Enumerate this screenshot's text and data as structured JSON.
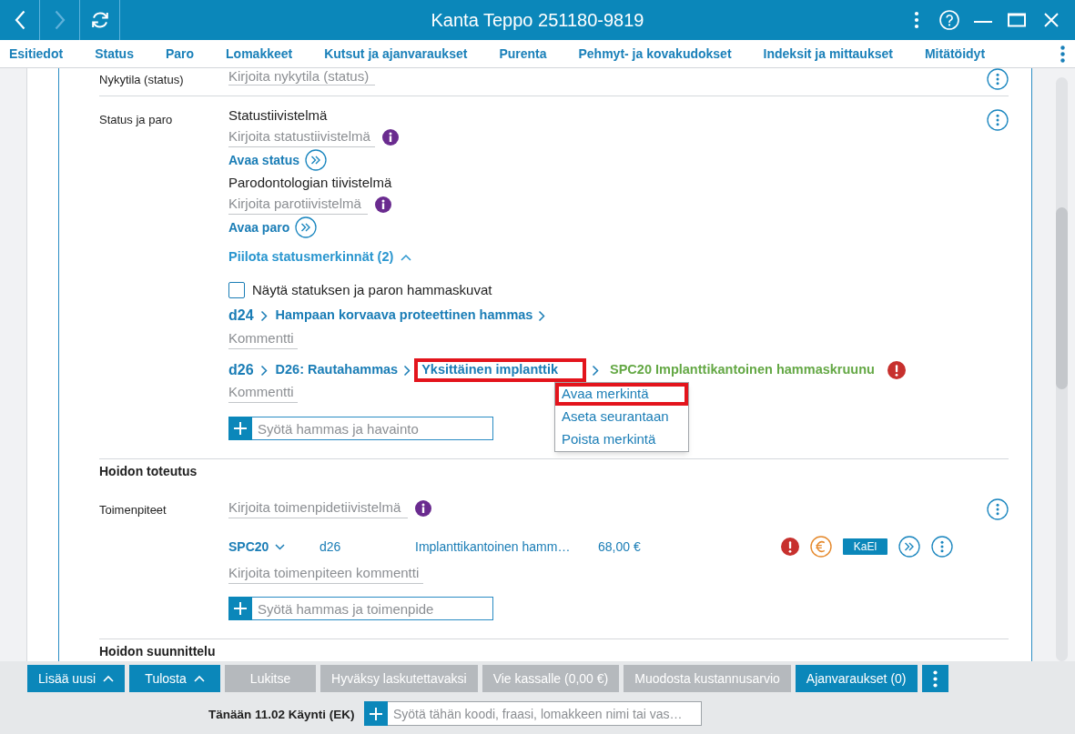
{
  "window": {
    "title": "Kanta Teppo 251180-9819"
  },
  "nav_buttons": [
    {
      "kind": "back",
      "disabled": false
    },
    {
      "kind": "forward",
      "disabled": true
    },
    {
      "kind": "refresh",
      "disabled": false
    }
  ],
  "tabs": [
    {
      "label": "Esitiedot",
      "selected": false
    },
    {
      "label": "Status",
      "selected": false
    },
    {
      "label": "Paro",
      "selected": false
    },
    {
      "label": "Lomakkeet",
      "selected": false
    },
    {
      "label": "Kutsut ja ajanvaraukset",
      "selected": false
    },
    {
      "label": "Purenta",
      "selected": false
    },
    {
      "label": "Pehmyt- ja kovakudokset",
      "selected": false
    },
    {
      "label": "Indeksit ja mittaukset",
      "selected": false
    },
    {
      "label": "Mitätöidyt",
      "selected": false
    }
  ],
  "current_state": {
    "label": "Nykytila (status)",
    "placeholder": "Kirjoita nykytila (status)"
  },
  "status_and_paro": {
    "label": "Status ja paro",
    "summaries": [
      {
        "heading": "Statustiivistelmä",
        "placeholder": "Kirjoita statustiivistelmä",
        "link": "Avaa status"
      },
      {
        "heading": "Parodontologian tiivistelmä",
        "placeholder": "Kirjoita parotiivistelmä",
        "link": "Avaa paro"
      }
    ],
    "toggle": {
      "label": "Piilota statusmerkinnät (2)",
      "expanded": true
    },
    "show_images": {
      "label": "Näytä statuksen ja paron hammaskuvat",
      "checked": false
    },
    "findings": [
      {
        "tooth": "d24",
        "path": [
          {
            "kind": "link",
            "text": "Hampaan korvaava proteettinen hammas",
            "highlighted": false
          }
        ],
        "comment_placeholder": "Kommentti",
        "warning": false
      },
      {
        "tooth": "d26",
        "path": [
          {
            "kind": "link",
            "text": "D26: Rautahammas",
            "highlighted": false
          },
          {
            "kind": "link",
            "text": "Yksittäinen implanttik",
            "highlighted": true
          },
          {
            "kind": "procedure",
            "text": "SPC20 Implanttikantoinen hammaskruunu",
            "highlighted": false
          }
        ],
        "comment_placeholder": "Kommentti",
        "warning": true,
        "menu": [
          {
            "label": "Avaa merkintä",
            "highlighted": true
          },
          {
            "label": "Aseta seurantaan",
            "highlighted": false
          },
          {
            "label": "Poista merkintä",
            "highlighted": false
          }
        ]
      }
    ],
    "add_field": {
      "placeholder": "Syötä hammas ja havainto"
    }
  },
  "treatment": {
    "heading": "Hoidon toteutus",
    "label": "Toimenpiteet",
    "placeholder": "Kirjoita toimenpidetiivistelmä",
    "procedures": [
      {
        "code": "SPC20",
        "tooth": "d26",
        "description": "Implanttikantoinen hamm…",
        "price": "68,00 €",
        "warning": true,
        "billable": true,
        "tag": "KaEl",
        "comment_placeholder": "Kirjoita toimenpiteen kommentti"
      }
    ],
    "add_field": {
      "placeholder": "Syötä hammas ja toimenpide"
    }
  },
  "planning": {
    "heading": "Hoidon suunnittelu"
  },
  "toolbar": [
    {
      "kind": "dropdown",
      "label": "Lisää uusi",
      "disabled": false
    },
    {
      "kind": "dropdown",
      "label": "Tulosta",
      "disabled": false
    },
    {
      "kind": "button",
      "label": "Lukitse",
      "disabled": true
    },
    {
      "kind": "button",
      "label": "Hyväksy laskutettavaksi",
      "disabled": true
    },
    {
      "kind": "button",
      "label": "Vie kassalle (0,00 €)",
      "disabled": true
    },
    {
      "kind": "button",
      "label": "Muodosta kustannusarvio",
      "disabled": true
    },
    {
      "kind": "button",
      "label": "Ajanvaraukset (0)",
      "disabled": false
    },
    {
      "kind": "more",
      "disabled": false
    }
  ],
  "visit": {
    "label": "Tänään 11.02 Käynti (EK)",
    "placeholder": "Syötä tähän koodi, fraasi, lomakkeen nimi tai vas…"
  }
}
